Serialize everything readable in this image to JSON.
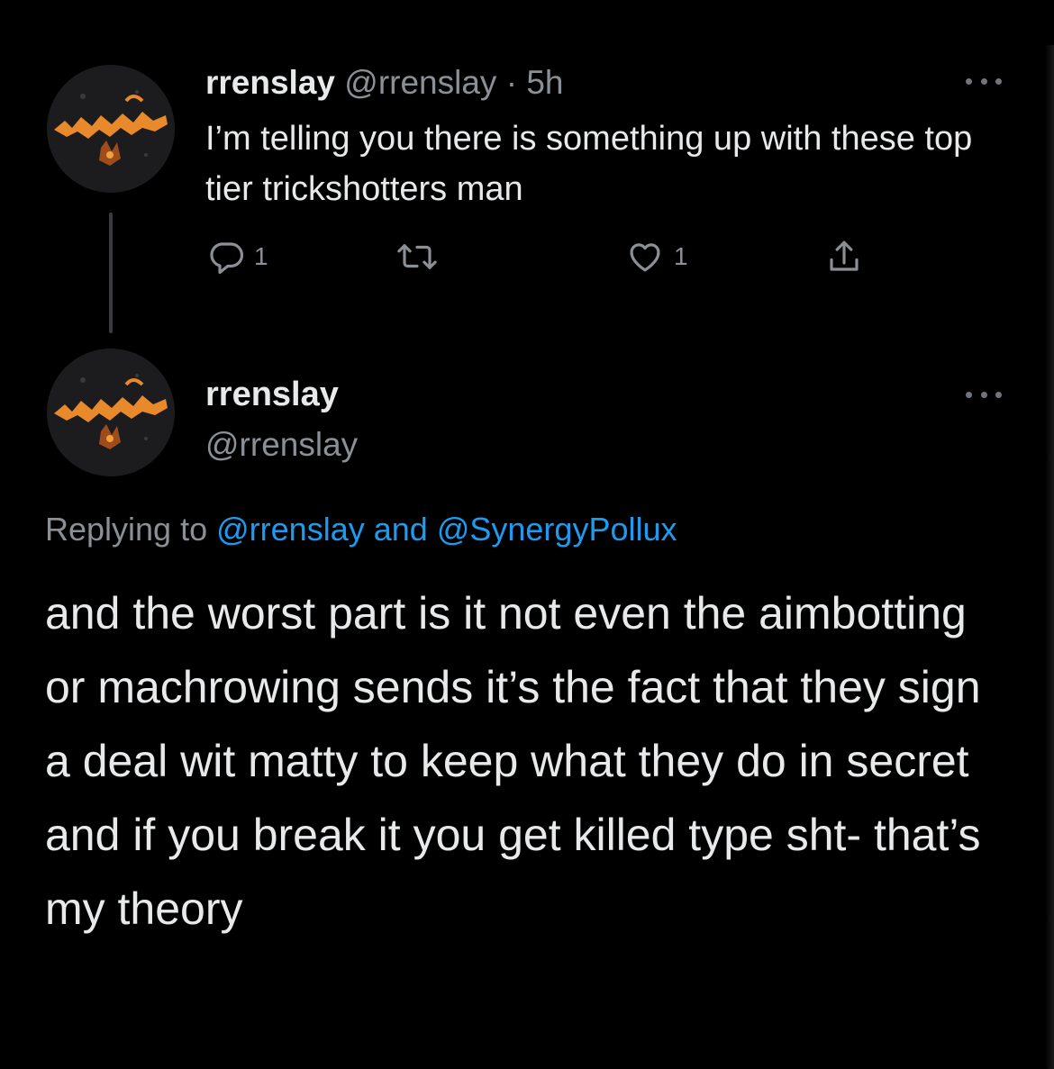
{
  "tweet1": {
    "display_name": "rrenslay",
    "handle": "@rrenslay",
    "separator": "·",
    "time": "5h",
    "text": "I’m telling you there is something up with these top tier trickshotters man",
    "actions": {
      "reply_count": "1",
      "like_count": "1"
    }
  },
  "tweet2": {
    "display_name": "rrenslay",
    "handle": "@rrenslay",
    "replying_prefix": "Replying to",
    "replying_mention_1": "@rrenslay",
    "replying_and": "and",
    "replying_mention_2": "@SynergyPollux",
    "text": "and the worst part is it not even the aimbotting or machrowing sends it’s the fact that they sign a deal wit matty to keep what they do in secret and if you break it you get killed type sht- that’s my theory"
  },
  "icons": {
    "reply": "reply-icon",
    "retweet": "retweet-icon",
    "like": "heart-icon",
    "share": "share-icon",
    "more": "more-options-icon"
  },
  "colors": {
    "background": "#000000",
    "primary_text": "#e7e9ea",
    "secondary_text": "#8b9096",
    "link": "#1d9bf0",
    "avatar_accent": "#e8892b"
  }
}
